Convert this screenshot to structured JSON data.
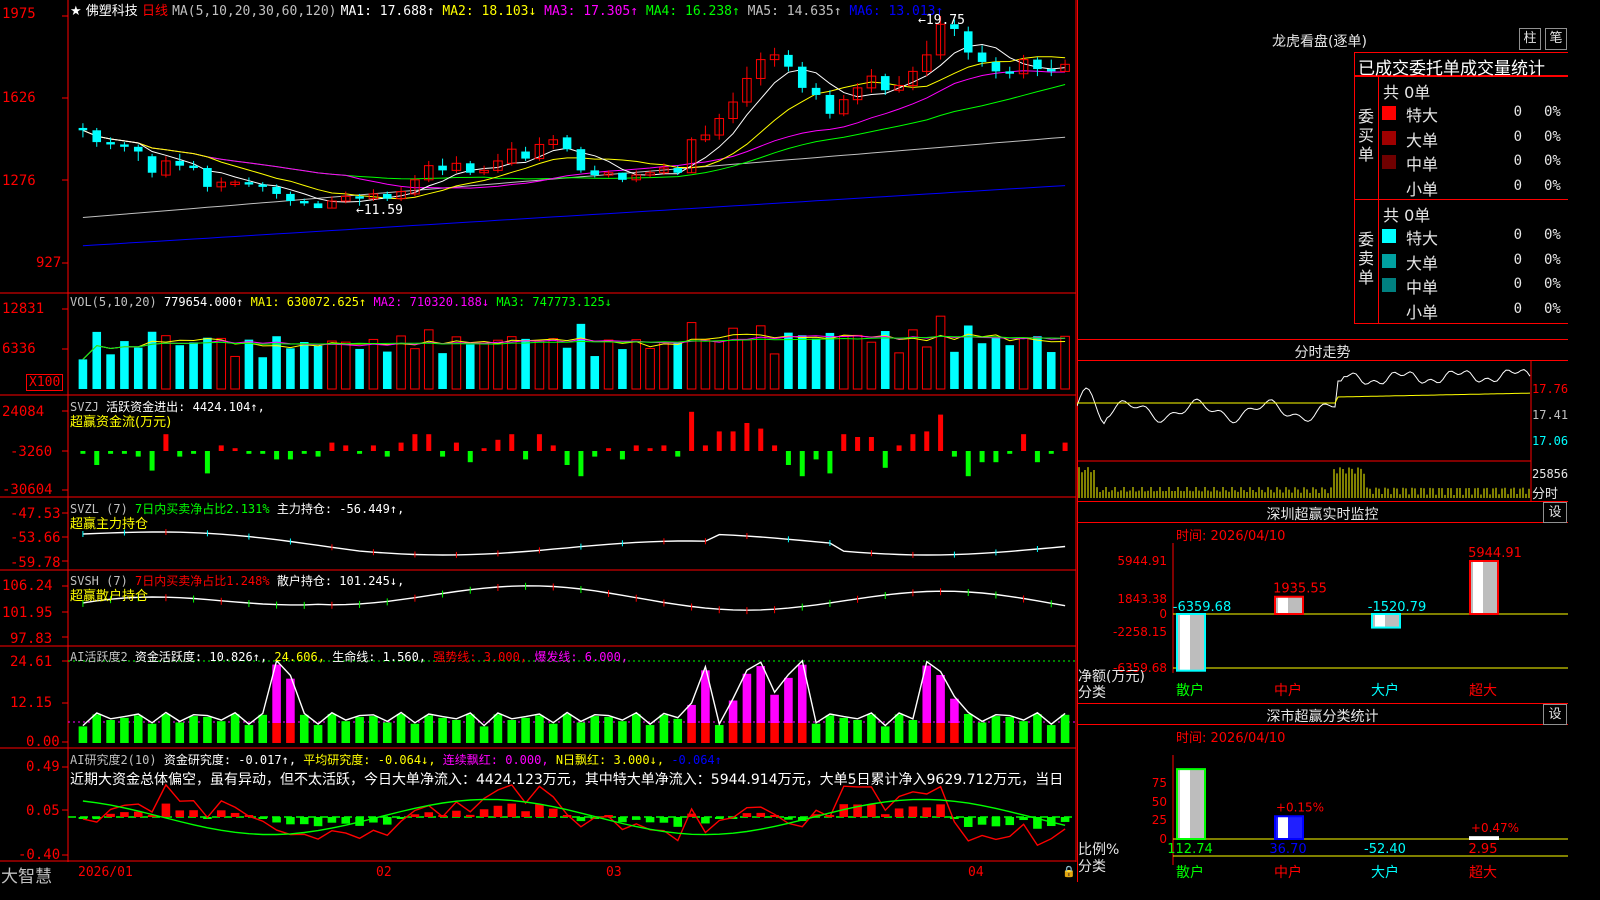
{
  "stock": {
    "star": "★",
    "name": "佛塑科技",
    "period": "日线"
  },
  "ma_header": {
    "label": "MA(5,10,20,30,60,120)",
    "items": [
      {
        "text": "MA1: 17.688↑",
        "color": "#ffffff"
      },
      {
        "text": "MA2: 18.103↓",
        "color": "#ffff00"
      },
      {
        "text": "MA3: 17.305↑",
        "color": "#ff00ff"
      },
      {
        "text": "MA4: 16.238↑",
        "color": "#00ff00"
      },
      {
        "text": "MA5: 14.635↑",
        "color": "#c0c0c0"
      },
      {
        "text": "MA6: 13.013↑",
        "color": "#0000ff"
      }
    ]
  },
  "price_axis": [
    "1975",
    "1626",
    "1276",
    "927"
  ],
  "price_marks": {
    "high": "←19.75",
    "low": "←11.59"
  },
  "vol": {
    "header": "VOL(5,10,20)",
    "v": "779654.000↑",
    "ma1": "MA1: 630072.625↑",
    "ma2": "MA2: 710320.188↓",
    "ma3": "MA3: 747773.125↓",
    "axis": [
      "12831",
      "6336"
    ],
    "unit": "X100"
  },
  "svzj": {
    "header": "SVZJ",
    "label": "活跃资金进出: 4424.104↑,",
    "sub": "超赢资金流(万元)",
    "axis": [
      "24084",
      "-3260",
      "-30604"
    ]
  },
  "svzl": {
    "header": "SVZL (7)",
    "ratio": "7日内买卖净占比2.131%",
    "hold": "主力持仓: -56.449↑,",
    "sub": "超赢主力持仓",
    "axis": [
      "-47.53",
      "-53.66",
      "-59.78"
    ]
  },
  "svsh": {
    "header": "SVSH (7)",
    "ratio": "7日内买卖净占比1.248%",
    "hold": "散户持仓: 101.245↓,",
    "sub": "超赢散户持仓",
    "axis": [
      "106.24",
      "101.95",
      "97.83"
    ]
  },
  "ai1": {
    "header": "AI活跃度2",
    "a": "资金活跃度: 10.826↑,",
    "b": "24.606,",
    "c": "生命线: 1.560,",
    "d": "强势线: 3.000,",
    "e": "爆发线: 6.000,",
    "axis": [
      "24.61",
      "12.15",
      "0.00"
    ]
  },
  "ai2": {
    "header": "AI研究度2(10)",
    "a": "资金研究度: -0.017↑,",
    "b": "平均研究度: -0.064↓,",
    "c": "连续飘红: 0.000,",
    "d": "N日飘红: 3.000↓,",
    "e": "-0.064↑",
    "axis": [
      "0.49",
      "0.05",
      "-0.40"
    ],
    "text": "近期大资金总体偏空，虽有异动，但不太活跃，今日大单净流入：4424.123万元，其中特大单净流入：5944.914万元，大单5日累计净入9629.712万元，当日"
  },
  "date_axis": [
    "2026/01",
    "02",
    "03",
    "04"
  ],
  "brand": "大智慧",
  "right": {
    "title": "龙虎看盘(逐单)",
    "btn1": "柱",
    "btn2": "笔",
    "tabs": "已成交委托单成交量统计",
    "buy": {
      "label": "委买单",
      "total": "共 0单",
      "rows": [
        {
          "name": "特大",
          "count": "0",
          "pct": "0%",
          "color": "#ff0000"
        },
        {
          "name": "大单",
          "count": "0",
          "pct": "0%",
          "color": "#a00000"
        },
        {
          "name": "中单",
          "count": "0",
          "pct": "0%",
          "color": "#700000"
        },
        {
          "name": "小单",
          "count": "0",
          "pct": "0%",
          "color": ""
        }
      ]
    },
    "sell": {
      "label": "委卖单",
      "total": "共 0单",
      "rows": [
        {
          "name": "特大",
          "count": "0",
          "pct": "0%",
          "color": "#00ffff"
        },
        {
          "name": "大单",
          "count": "0",
          "pct": "0%",
          "color": "#00a0a0"
        },
        {
          "name": "中单",
          "count": "0",
          "pct": "0%",
          "color": "#008080"
        },
        {
          "name": "小单",
          "count": "0",
          "pct": "0%",
          "color": ""
        }
      ]
    },
    "intraday": {
      "title": "分时走势",
      "axis": [
        "17.76",
        "17.41",
        "17.06"
      ],
      "vol_axis": "25856",
      "vol_label": "分时"
    },
    "monitor": {
      "title": "深圳超赢实时监控",
      "btn": "设",
      "time": "时间: 2026/04/10",
      "axis": [
        "5944.91",
        "1843.38",
        "0",
        "-2258.15",
        "-6359.68"
      ],
      "net_label": "净额(万元)",
      "cat_label": "分类",
      "categories": [
        "散户",
        "中户",
        "大户",
        "超大"
      ],
      "values": [
        -6359.68,
        1935.55,
        -1520.79,
        5944.91
      ],
      "value_labels": [
        "-6359.68",
        "1935.55",
        "-1520.79",
        "5944.91"
      ]
    },
    "classify": {
      "title": "深市超赢分类统计",
      "btn": "设",
      "time": "时间: 2026/04/10",
      "axis": [
        "75",
        "50",
        "25",
        "0"
      ],
      "ratio_label": "比例%",
      "cat_label": "分类",
      "categories": [
        "散户",
        "中户",
        "大户",
        "超大"
      ],
      "values": [
        "112.74",
        "36.70",
        "-52.40",
        "2.95"
      ],
      "deltas": [
        "",
        "+0.15%",
        "",
        "+0.47%"
      ]
    }
  },
  "chart_data": {
    "type": "candlestick",
    "symbol": "佛塑科技",
    "period": "日线",
    "x_ticks": [
      "2026/01",
      "02",
      "03",
      "04"
    ],
    "y_ticks": [
      19.75,
      16.26,
      12.76,
      9.27
    ],
    "annotations": [
      {
        "label": "19.75",
        "type": "high"
      },
      {
        "label": "11.59",
        "type": "low"
      }
    ],
    "candles": [
      [
        15.0,
        14.9,
        15.2,
        14.6
      ],
      [
        14.9,
        14.4,
        15.0,
        14.2
      ],
      [
        14.4,
        14.3,
        14.6,
        14.1
      ],
      [
        14.3,
        14.2,
        14.4,
        14.0
      ],
      [
        14.2,
        14.0,
        14.3,
        13.6
      ],
      [
        13.8,
        13.1,
        13.9,
        12.9
      ],
      [
        13.0,
        13.6,
        13.8,
        12.9
      ],
      [
        13.6,
        13.4,
        13.9,
        13.2
      ],
      [
        13.4,
        13.3,
        13.6,
        13.2
      ],
      [
        13.3,
        12.5,
        13.4,
        12.3
      ],
      [
        12.5,
        12.7,
        12.9,
        12.3
      ],
      [
        12.6,
        12.7,
        12.8,
        12.5
      ],
      [
        12.7,
        12.6,
        12.9,
        12.5
      ],
      [
        12.6,
        12.5,
        12.7,
        12.3
      ],
      [
        12.5,
        12.2,
        12.6,
        12.0
      ],
      [
        12.2,
        11.9,
        12.3,
        11.7
      ],
      [
        11.9,
        11.8,
        12.0,
        11.7
      ],
      [
        11.8,
        11.6,
        11.9,
        11.6
      ],
      [
        11.6,
        11.9,
        12.1,
        11.6
      ],
      [
        11.9,
        12.1,
        12.3,
        11.8
      ],
      [
        12.1,
        12.0,
        12.2,
        11.7
      ],
      [
        12.0,
        12.2,
        12.4,
        11.9
      ],
      [
        12.2,
        12.0,
        12.3,
        11.9
      ],
      [
        12.0,
        12.3,
        12.5,
        11.9
      ],
      [
        12.2,
        12.8,
        13.0,
        12.1
      ],
      [
        12.8,
        13.4,
        13.6,
        12.7
      ],
      [
        13.4,
        13.2,
        13.7,
        13.0
      ],
      [
        13.2,
        13.5,
        13.8,
        13.1
      ],
      [
        13.5,
        13.1,
        13.6,
        13.0
      ],
      [
        13.1,
        13.2,
        13.4,
        13.0
      ],
      [
        13.2,
        13.6,
        13.9,
        13.1
      ],
      [
        13.5,
        14.1,
        14.4,
        13.4
      ],
      [
        14.0,
        13.7,
        14.2,
        13.6
      ],
      [
        13.7,
        14.3,
        14.6,
        13.6
      ],
      [
        14.3,
        14.5,
        14.7,
        14.1
      ],
      [
        14.6,
        14.1,
        14.7,
        14.0
      ],
      [
        14.1,
        13.2,
        14.2,
        13.1
      ],
      [
        13.2,
        13.0,
        13.4,
        12.9
      ],
      [
        13.0,
        13.1,
        13.2,
        12.9
      ],
      [
        13.1,
        12.8,
        13.1,
        12.7
      ],
      [
        12.8,
        13.0,
        13.2,
        12.7
      ],
      [
        13.0,
        13.1,
        13.2,
        12.9
      ],
      [
        13.1,
        13.3,
        13.5,
        13.0
      ],
      [
        13.3,
        13.1,
        13.4,
        13.0
      ],
      [
        13.1,
        14.5,
        14.6,
        13.1
      ],
      [
        14.5,
        14.7,
        15.1,
        14.4
      ],
      [
        14.7,
        15.4,
        15.6,
        14.5
      ],
      [
        15.4,
        16.1,
        16.5,
        15.2
      ],
      [
        16.1,
        17.1,
        17.6,
        15.9
      ],
      [
        17.1,
        17.9,
        18.2,
        16.8
      ],
      [
        17.9,
        18.1,
        18.4,
        17.6
      ],
      [
        18.1,
        17.6,
        18.3,
        17.4
      ],
      [
        17.6,
        16.7,
        17.8,
        16.5
      ],
      [
        16.7,
        16.4,
        16.9,
        16.2
      ],
      [
        16.4,
        15.6,
        16.6,
        15.4
      ],
      [
        15.6,
        16.2,
        16.4,
        15.5
      ],
      [
        16.2,
        16.7,
        16.9,
        16.0
      ],
      [
        16.7,
        17.2,
        17.5,
        16.5
      ],
      [
        17.2,
        16.6,
        17.3,
        16.4
      ],
      [
        16.6,
        16.8,
        17.2,
        16.5
      ],
      [
        16.8,
        17.4,
        17.6,
        16.6
      ],
      [
        17.4,
        18.1,
        18.7,
        17.2
      ],
      [
        18.1,
        19.4,
        19.75,
        17.9
      ],
      [
        19.4,
        19.2,
        19.6,
        18.9
      ],
      [
        19.1,
        18.2,
        19.3,
        17.9
      ],
      [
        18.2,
        17.8,
        18.5,
        17.6
      ],
      [
        17.8,
        17.4,
        18.0,
        17.1
      ],
      [
        17.4,
        17.3,
        17.6,
        17.1
      ],
      [
        17.3,
        17.9,
        18.1,
        17.1
      ],
      [
        17.9,
        17.5,
        18.0,
        17.2
      ],
      [
        17.5,
        17.4,
        17.9,
        17.2
      ],
      [
        17.4,
        17.7,
        17.9,
        17.4
      ]
    ]
  }
}
